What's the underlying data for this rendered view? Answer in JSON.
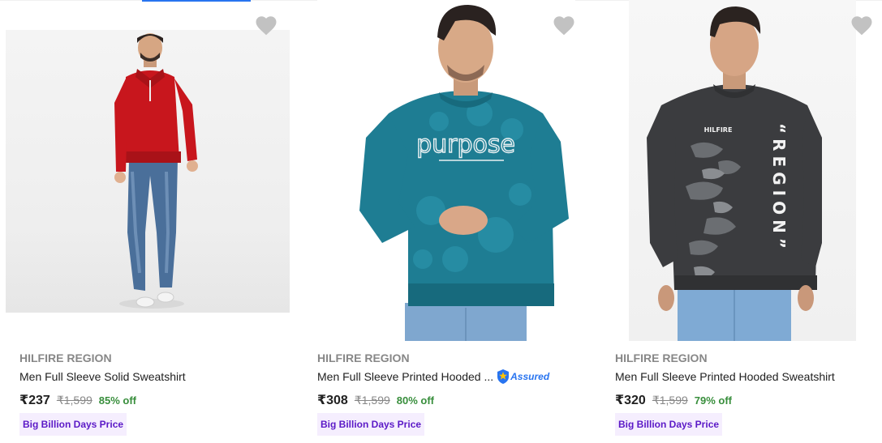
{
  "products": [
    {
      "brand": "HILFIRE REGION",
      "title": "Men Full Sleeve Solid Sweatshirt",
      "price": "₹237",
      "mrp": "₹1,599",
      "discount": "85% off",
      "badge": "Big Billion Days Price",
      "image": "man-in-red-zip-sweatshirt",
      "assured": false
    },
    {
      "brand": "HILFIRE REGION",
      "title": "Men Full Sleeve Printed Hooded ...",
      "price": "₹308",
      "mrp": "₹1,599",
      "discount": "80% off",
      "badge": "Big Billion Days Price",
      "image": "man-in-teal-purpose-sweatshirt",
      "assured": true,
      "assured_label": "Assured"
    },
    {
      "brand": "HILFIRE REGION",
      "title": "Men Full Sleeve Printed Hooded Sweatshirt",
      "price": "₹320",
      "mrp": "₹1,599",
      "discount": "79% off",
      "badge": "Big Billion Days Price",
      "image": "man-in-grey-camo-region-sweatshirt",
      "assured": false
    }
  ],
  "colors": {
    "brand_grey": "#878787",
    "discount_green": "#388e3c",
    "badge_bg": "#f5eefe",
    "badge_text": "#5b19c7",
    "assured_blue": "#2874f0",
    "heart_grey": "#c2c2c2"
  },
  "icons": {
    "wishlist": "heart-icon",
    "assured": "assured-shield-icon"
  },
  "illustration_text": {
    "purpose_print": "purpose",
    "hilfire_chest": "HILFIRE",
    "region_print": "“REGION”"
  }
}
